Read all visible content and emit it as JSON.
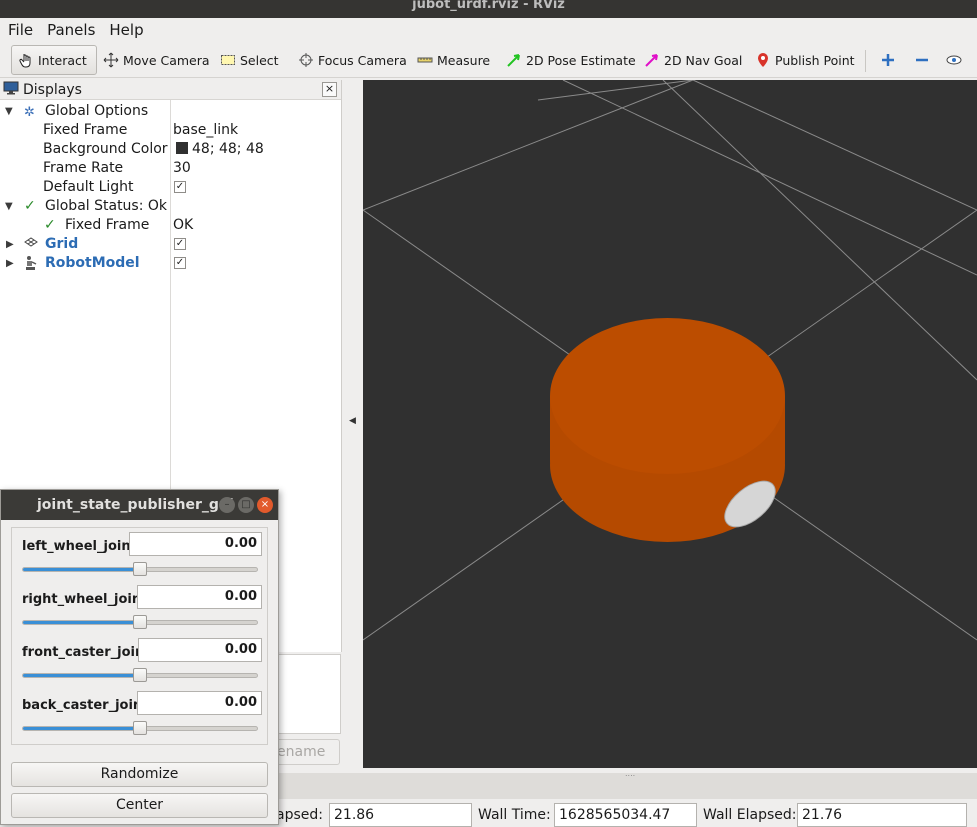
{
  "window": {
    "title": "jubot_urdf.rviz - RViz"
  },
  "menu": {
    "file": "File",
    "panels": "Panels",
    "help": "Help"
  },
  "toolbar": {
    "interact": "Interact",
    "move_camera": "Move Camera",
    "select": "Select",
    "focus_camera": "Focus Camera",
    "measure": "Measure",
    "pose_estimate": "2D Pose Estimate",
    "nav_goal": "2D Nav Goal",
    "publish_point": "Publish Point"
  },
  "displays": {
    "title": "Displays",
    "close": "×",
    "global_options": "Global Options",
    "fixed_frame_label": "Fixed Frame",
    "fixed_frame_value": "base_link",
    "bg_color_label": "Background Color",
    "bg_color_value": "48; 48; 48",
    "bg_color_hex": "#303030",
    "frame_rate_label": "Frame Rate",
    "frame_rate_value": "30",
    "default_light_label": "Default Light",
    "global_status": "Global Status: Ok",
    "status_fixed_frame": "Fixed Frame",
    "status_fixed_frame_value": "OK",
    "grid": "Grid",
    "robot_model": "RobotModel",
    "check": "✓"
  },
  "rename": "ename",
  "time": {
    "ros_elapsed_label": "apsed:",
    "ros_elapsed": "21.86",
    "wall_time_label": "Wall Time:",
    "wall_time": "1628565034.47",
    "wall_elapsed_label": "Wall Elapsed:",
    "wall_elapsed": "21.76"
  },
  "jsp": {
    "title": "joint_state_publisher_gui",
    "joints": [
      {
        "name": "left_wheel_joint",
        "value": "0.00",
        "slider_position": 0.5
      },
      {
        "name": "right_wheel_joint",
        "value": "0.00",
        "slider_position": 0.5
      },
      {
        "name": "front_caster_joint",
        "value": "0.00",
        "slider_position": 0.5
      },
      {
        "name": "back_caster_joint",
        "value": "0.00",
        "slider_position": 0.5
      }
    ],
    "randomize": "Randomize",
    "center": "Center"
  },
  "colors": {
    "robot": "#b54a00",
    "grid": "#8a8a8a",
    "caster": "#d6d6d6"
  }
}
